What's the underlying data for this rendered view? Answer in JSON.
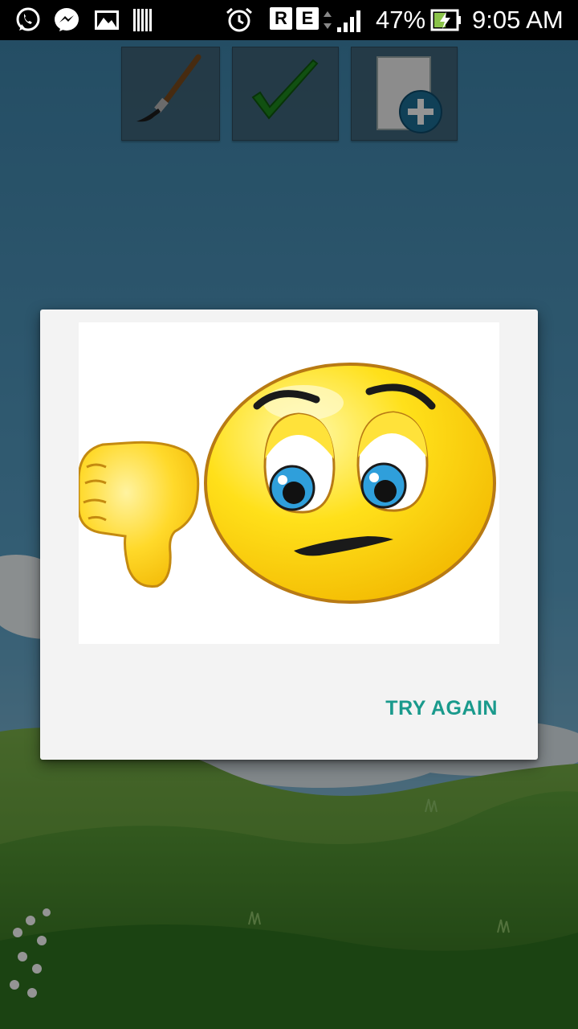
{
  "status_bar": {
    "network_badge_1": "R",
    "network_badge_2": "E",
    "battery_percent": "47%",
    "time": "9:05 AM",
    "icons": [
      "whatsapp-icon",
      "messenger-icon",
      "gallery-icon",
      "barcode-icon",
      "alarm-icon",
      "signal-icon",
      "battery-charging-icon"
    ]
  },
  "toolbar": {
    "buttons": [
      {
        "icon": "paintbrush-icon"
      },
      {
        "icon": "checkmark-icon"
      },
      {
        "icon": "new-page-icon"
      }
    ]
  },
  "dialog": {
    "image": "sad-emoji-thumbs-down-image",
    "button_label": "TRY AGAIN"
  },
  "colors": {
    "accent": "#1a9a8c",
    "dialog_background": "#f3f3f3",
    "status_bar": "#000000"
  }
}
